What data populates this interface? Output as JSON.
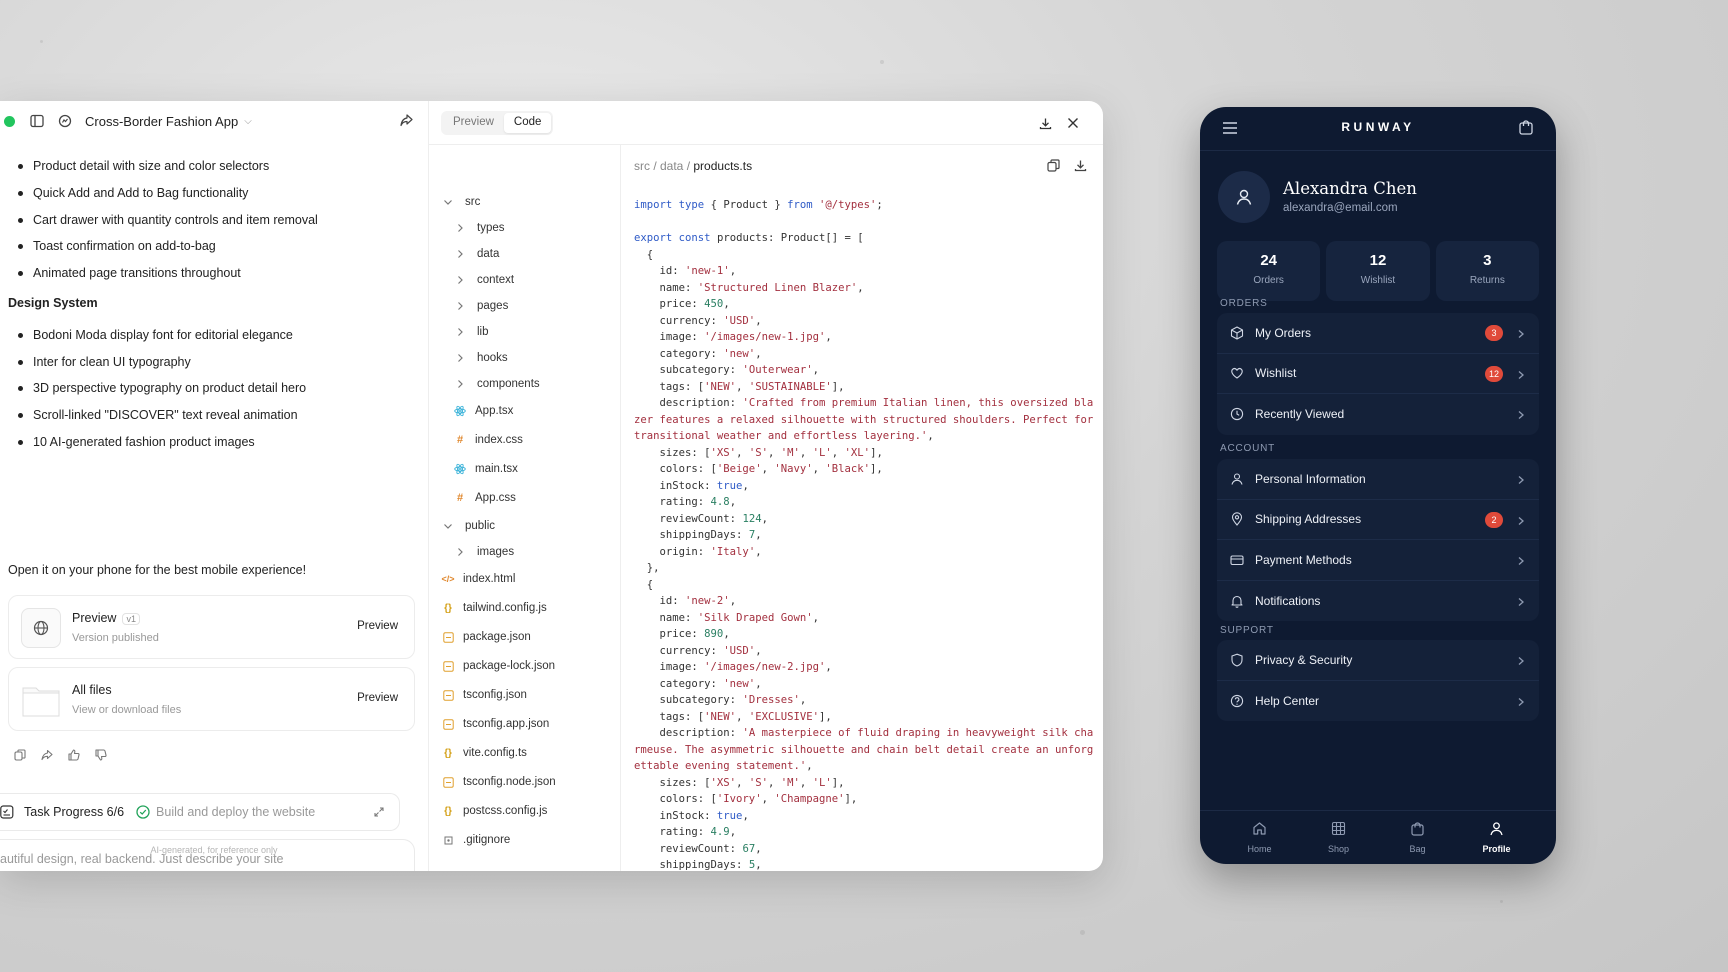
{
  "chat": {
    "project_title": "Cross-Border Fashion App",
    "bullets_top": [
      "Product detail with size and color selectors",
      "Quick Add and Add to Bag functionality",
      "Cart drawer with quantity controls and item removal",
      "Toast confirmation on add-to-bag",
      "Animated page transitions throughout"
    ],
    "design_heading": "Design System",
    "bullets_design": [
      "Bodoni Moda display font for editorial elegance",
      "Inter for clean UI typography",
      "3D perspective typography on product detail hero",
      "Scroll-linked \"DISCOVER\" text reveal animation",
      "10 AI-generated fashion product images"
    ],
    "open_line": "Open it on your phone for the best mobile experience!",
    "preview_card": {
      "title": "Preview",
      "badge": "v1",
      "subtitle": "Version published",
      "button": "Preview"
    },
    "files_card": {
      "title": "All files",
      "subtitle": "View or download files",
      "button": "Preview"
    },
    "task": {
      "title": "Task Progress 6/6",
      "description": "Build and deploy the website"
    },
    "composer_placeholder": "autiful design, real backend. Just describe your site",
    "disclaimer": "AI-generated, for reference only"
  },
  "toolbar": {
    "tab_preview": "Preview",
    "tab_code": "Code"
  },
  "tree": [
    {
      "label": "src",
      "kind": "folder-open",
      "depth": 0
    },
    {
      "label": "types",
      "kind": "folder",
      "depth": 1
    },
    {
      "label": "data",
      "kind": "folder",
      "depth": 1
    },
    {
      "label": "context",
      "kind": "folder",
      "depth": 1
    },
    {
      "label": "pages",
      "kind": "folder",
      "depth": 1
    },
    {
      "label": "lib",
      "kind": "folder",
      "depth": 1
    },
    {
      "label": "hooks",
      "kind": "folder",
      "depth": 1
    },
    {
      "label": "components",
      "kind": "folder",
      "depth": 1
    },
    {
      "label": "App.tsx",
      "kind": "react",
      "depth": 1
    },
    {
      "label": "index.css",
      "kind": "css",
      "depth": 1
    },
    {
      "label": "main.tsx",
      "kind": "react",
      "depth": 1
    },
    {
      "label": "App.css",
      "kind": "css",
      "depth": 1
    },
    {
      "label": "public",
      "kind": "folder-open",
      "depth": 0
    },
    {
      "label": "images",
      "kind": "folder",
      "depth": 1
    },
    {
      "label": "index.html",
      "kind": "html",
      "depth": 0
    },
    {
      "label": "tailwind.config.js",
      "kind": "js",
      "depth": 0
    },
    {
      "label": "package.json",
      "kind": "json",
      "depth": 0
    },
    {
      "label": "package-lock.json",
      "kind": "json",
      "depth": 0
    },
    {
      "label": "tsconfig.json",
      "kind": "json",
      "depth": 0
    },
    {
      "label": "tsconfig.app.json",
      "kind": "json",
      "depth": 0
    },
    {
      "label": "vite.config.ts",
      "kind": "js",
      "depth": 0
    },
    {
      "label": "tsconfig.node.json",
      "kind": "json",
      "depth": 0
    },
    {
      "label": "postcss.config.js",
      "kind": "js",
      "depth": 0
    },
    {
      "label": ".gitignore",
      "kind": "git",
      "depth": 0
    }
  ],
  "code": {
    "path_dirs": "src / data /",
    "path_file": "products.ts",
    "lines": [
      "import type { Product } from '@/types';",
      "",
      "export const products: Product[] = [",
      "  {",
      "    id: 'new-1',",
      "    name: 'Structured Linen Blazer',",
      "    price: 450,",
      "    currency: 'USD',",
      "    image: '/images/new-1.jpg',",
      "    category: 'new',",
      "    subcategory: 'Outerwear',",
      "    tags: ['NEW', 'SUSTAINABLE'],",
      "    description: 'Crafted from premium Italian linen, this oversized blazer features a relaxed silhouette with structured shoulders. Perfect for transitional weather and effortless layering.',",
      "    sizes: ['XS', 'S', 'M', 'L', 'XL'],",
      "    colors: ['Beige', 'Navy', 'Black'],",
      "    inStock: true,",
      "    rating: 4.8,",
      "    reviewCount: 124,",
      "    shippingDays: 7,",
      "    origin: 'Italy',",
      "  },",
      "  {",
      "    id: 'new-2',",
      "    name: 'Silk Draped Gown',",
      "    price: 890,",
      "    currency: 'USD',",
      "    image: '/images/new-2.jpg',",
      "    category: 'new',",
      "    subcategory: 'Dresses',",
      "    tags: ['NEW', 'EXCLUSIVE'],",
      "    description: 'A masterpiece of fluid draping in heavyweight silk charmeuse. The asymmetric silhouette and chain belt detail create an unforgettable evening statement.',",
      "    sizes: ['XS', 'S', 'M', 'L'],",
      "    colors: ['Ivory', 'Champagne'],",
      "    inStock: true,",
      "    rating: 4.9,",
      "    reviewCount: 67,",
      "    shippingDays: 5,"
    ]
  },
  "phone": {
    "brand": "RUNWAY",
    "user_name": "Alexandra Chen",
    "user_email": "alexandra@email.com",
    "stats": [
      {
        "value": "24",
        "label": "Orders"
      },
      {
        "value": "12",
        "label": "Wishlist"
      },
      {
        "value": "3",
        "label": "Returns"
      }
    ],
    "sections": [
      {
        "title": "ORDERS",
        "rows": [
          {
            "label": "My Orders",
            "icon": "package-icon",
            "badge": "3"
          },
          {
            "label": "Wishlist",
            "icon": "heart-icon",
            "badge": "12"
          },
          {
            "label": "Recently Viewed",
            "icon": "clock-icon",
            "badge": ""
          }
        ]
      },
      {
        "title": "ACCOUNT",
        "rows": [
          {
            "label": "Personal Information",
            "icon": "user-icon",
            "badge": ""
          },
          {
            "label": "Shipping Addresses",
            "icon": "map-pin-icon",
            "badge": "2"
          },
          {
            "label": "Payment Methods",
            "icon": "credit-card-icon",
            "badge": ""
          },
          {
            "label": "Notifications",
            "icon": "bell-icon",
            "badge": ""
          }
        ]
      },
      {
        "title": "SUPPORT",
        "rows": [
          {
            "label": "Privacy & Security",
            "icon": "shield-icon",
            "badge": ""
          },
          {
            "label": "Help Center",
            "icon": "help-circle-icon",
            "badge": ""
          }
        ]
      }
    ],
    "tabs": [
      {
        "label": "Home",
        "icon": "home-icon",
        "active": false
      },
      {
        "label": "Shop",
        "icon": "grid-icon",
        "active": false
      },
      {
        "label": "Bag",
        "icon": "bag-icon",
        "active": false
      },
      {
        "label": "Profile",
        "icon": "profile-icon",
        "active": true
      }
    ],
    "colors": {
      "background": "#0e1a31",
      "badge": "#e04a3a"
    }
  }
}
